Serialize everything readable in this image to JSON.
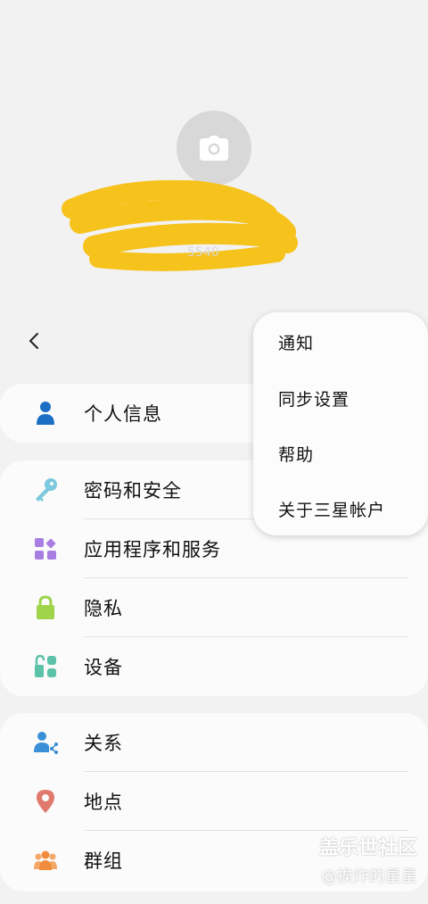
{
  "profile": {
    "avatar_icon": "camera-icon",
    "redacted_text": "5540"
  },
  "nav": {
    "back_icon": "back-arrow-icon"
  },
  "sections": {
    "personal": {
      "label": "个人信息",
      "icon": "person-icon"
    },
    "security": [
      {
        "label": "密码和安全",
        "icon": "key-icon"
      },
      {
        "label": "应用程序和服务",
        "icon": "apps-icon"
      },
      {
        "label": "隐私",
        "icon": "lock-icon"
      },
      {
        "label": "设备",
        "icon": "devices-icon"
      }
    ],
    "social": [
      {
        "label": "关系",
        "icon": "relationship-icon"
      },
      {
        "label": "地点",
        "icon": "location-pin-icon"
      },
      {
        "label": "群组",
        "icon": "group-icon"
      }
    ]
  },
  "menu": {
    "items": [
      "通知",
      "同步设置",
      "帮助",
      "关于三星帐户"
    ]
  },
  "watermark": {
    "line1": "盖乐世社区",
    "line2": "@挨炸的星星"
  },
  "colors": {
    "background": "#f2f2f2",
    "card": "#fbfbfb",
    "scribble": "#f6c21c",
    "person": "#1a6fc4",
    "key": "#7cc8dc",
    "apps": "#a97ee3",
    "lock": "#9fd44a",
    "devices": "#5cc2a8",
    "relationship": "#3a8fd6",
    "location": "#e07a6c",
    "group": "#f08a3c"
  }
}
